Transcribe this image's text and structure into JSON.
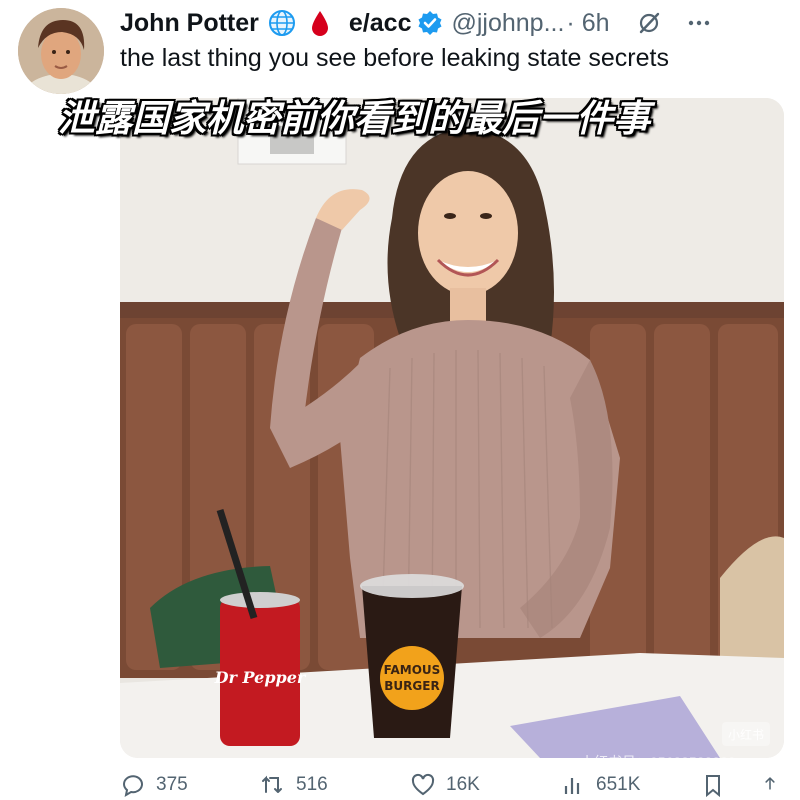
{
  "tweet": {
    "display_name": "John Potter",
    "handle_name": "e/acc",
    "handle": "@jjohnp...",
    "time": "· 6h",
    "text": "the last thing you see before leaking state secrets"
  },
  "caption_zh": "泄露国家机密前你看到的最后一件事",
  "photo": {
    "cup_logo_line1": "FAMOUS",
    "cup_logo_line2": "BURGER",
    "can_label": "Dr Pepper"
  },
  "actions": {
    "replies": "375",
    "retweets": "516",
    "likes": "16K",
    "views": "651K"
  },
  "watermark": {
    "text": "小红书号：95688528280",
    "logo": "小红书"
  },
  "icons": {
    "badge_1": "globe-icon",
    "badge_2": "drop-of-blood-icon",
    "verified": "verified-badge-icon",
    "grok": "grok-icon",
    "more": "more-icon"
  },
  "colors": {
    "text": "#0f1419",
    "muted": "#536471",
    "verified": "#1d9bf0",
    "blood": "#d6001c"
  }
}
